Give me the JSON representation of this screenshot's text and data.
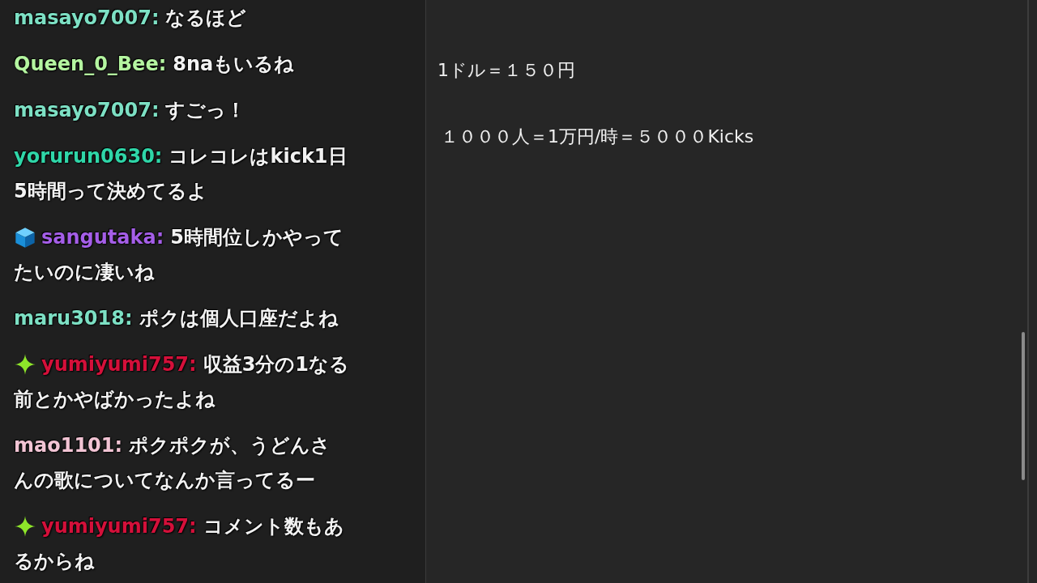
{
  "chat": {
    "messages": [
      {
        "kind": "plain",
        "user": "masayo7007:",
        "color": "#7de0c4",
        "lines": [
          "なるほど"
        ]
      },
      {
        "kind": "plain",
        "user": "Queen_0_Bee:",
        "color": "#b4f5a0",
        "lines": [
          "8naもいるね"
        ]
      },
      {
        "kind": "plain",
        "user": "masayo7007:",
        "color": "#7de0c4",
        "lines": [
          "すごっ！"
        ]
      },
      {
        "kind": "plain",
        "user": "yorurun0630:",
        "color": "#2fd6a8",
        "lines": [
          "コレコレはkick1日",
          "5時間って決めてるよ"
        ]
      },
      {
        "kind": "cube",
        "user": "sangutaka:",
        "color": "#a55ee8",
        "lines": [
          "5時間位しかやって",
          "たいのに凄いね"
        ]
      },
      {
        "kind": "plain",
        "user": "maru3018:",
        "color": "#7de0c4",
        "lines": [
          "ポクは個人口座だよね"
        ]
      },
      {
        "kind": "sparkle",
        "user": "yumiyumi757:",
        "color": "#d4103a",
        "lines": [
          "収益3分の1なる",
          "前とかやばかったよね"
        ]
      },
      {
        "kind": "plain",
        "user": "mao1101:",
        "color": "#f2c4d4",
        "lines": [
          "ポクポクが、うどんさ",
          "んの歌についてなんか言ってるー"
        ]
      },
      {
        "kind": "sparkle",
        "user": "yumiyumi757:",
        "color": "#d4103a",
        "lines": [
          "コメント数もあ",
          "るからね"
        ]
      }
    ]
  },
  "notes": {
    "lines": [
      "1ドル＝１５０円",
      "１０００人＝1万円/時＝５０００Kicks"
    ]
  }
}
